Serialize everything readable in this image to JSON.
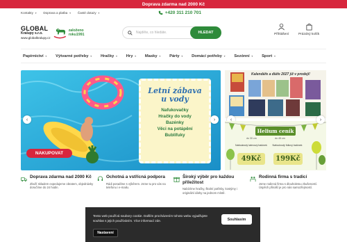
{
  "topbar": {
    "text": "Doprava zdarma nad 2000 Kč"
  },
  "util": {
    "links": [
      "Kontakty",
      "Doprava a platba",
      "Časté dotazy"
    ],
    "phone": "+420 311 210 701"
  },
  "logo": {
    "global": "GLOBAL",
    "kralupy": "Kralupy s.r.o.",
    "url": "www.globalkralupy.cz",
    "since_1": "založeno",
    "since_2": "roku1991"
  },
  "search": {
    "placeholder": "Najděte, co hledáte.",
    "button": "HLEDAT"
  },
  "header_actions": {
    "login": "Přihlášení",
    "cart": "Prázdný košík"
  },
  "nav": [
    "Papírnictví",
    "Výtvarné potřeby",
    "Hračky",
    "Hry",
    "Masky",
    "Párty",
    "Domácí potřeby",
    "Sezónní",
    "Sport"
  ],
  "banner": {
    "title": "Letní zábava u vody",
    "lines": [
      "Nafukovačky",
      "Hračky do vody",
      "Bazénky",
      "Věci na potápění",
      "Bublifuky"
    ],
    "cta": "NAKUPOVAT"
  },
  "calendar_banner": {
    "title": "Kalendáře a diáře 2027 již v prodeji!"
  },
  "helium_banner": {
    "title": "Helium ceník",
    "left_caption": "Nafouknutý latexový balónek",
    "right_caption": "Nafouknutý fóliový balónek",
    "size_left": "do 30 cm",
    "size_right": "do 45 cm",
    "price_left": "49Kč",
    "price_right": "199Kč"
  },
  "features": [
    {
      "title": "Doprava zdarma nad 2000 Kč",
      "desc": "Zboží skladem expedujeme obratem, objednávky doručíme do 24 hodin."
    },
    {
      "title": "Ochotná a vstřícná podpora",
      "desc": "Rádi poradíme s výběrem. Jsme tu pro vás na telefonu i e-mailu."
    },
    {
      "title": "Široký výběr pro každou příležitost",
      "desc": "Nabízíme hračky, školní potřeby, kostýmy i originální dárky na jednom místě."
    },
    {
      "title": "Rodinná firma s tradicí",
      "desc": "Jsme rodinná firma s dlouholetou zkušeností. Úspěch přináší je pro nás samozřejmostí."
    }
  ],
  "cookie": {
    "text": "Tento web používá soubory cookie. Dalším procházením tohoto webu vyjadřujete souhlas s jejich používáním. Více informací zde.",
    "accept": "Souhlasím",
    "settings": "Nastavení"
  },
  "colors": {
    "brand_red": "#d7263d",
    "brand_green": "#2e8b3a"
  }
}
